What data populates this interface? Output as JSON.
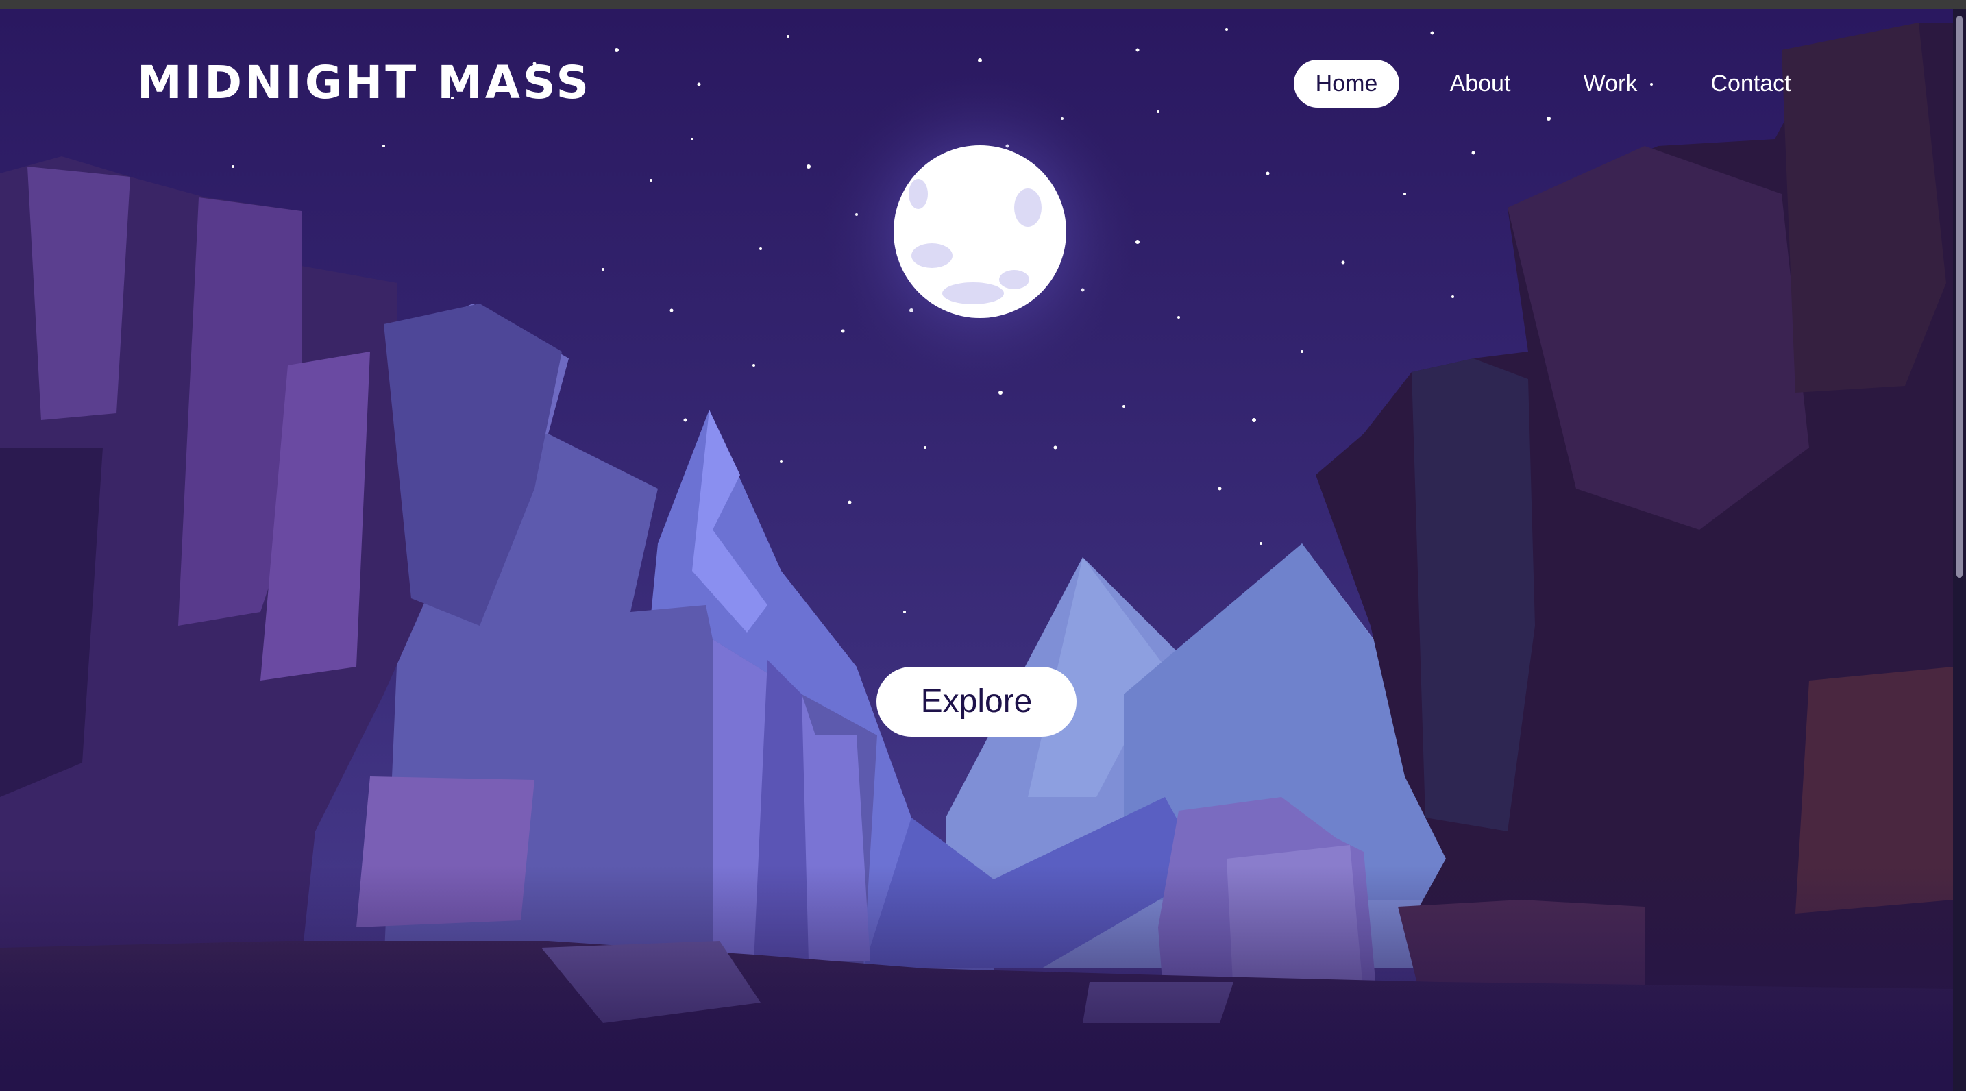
{
  "header": {
    "logo": "MIDNIGHT MASS"
  },
  "nav": {
    "items": [
      {
        "label": "Home",
        "active": true
      },
      {
        "label": "About",
        "active": false
      },
      {
        "label": "Work",
        "active": false
      },
      {
        "label": "Contact",
        "active": false
      }
    ]
  },
  "hero": {
    "cta_label": "Explore"
  },
  "colors": {
    "sky": "#2b1b5e",
    "moon": "#ffffff",
    "accent_dark": "#1e124a"
  }
}
